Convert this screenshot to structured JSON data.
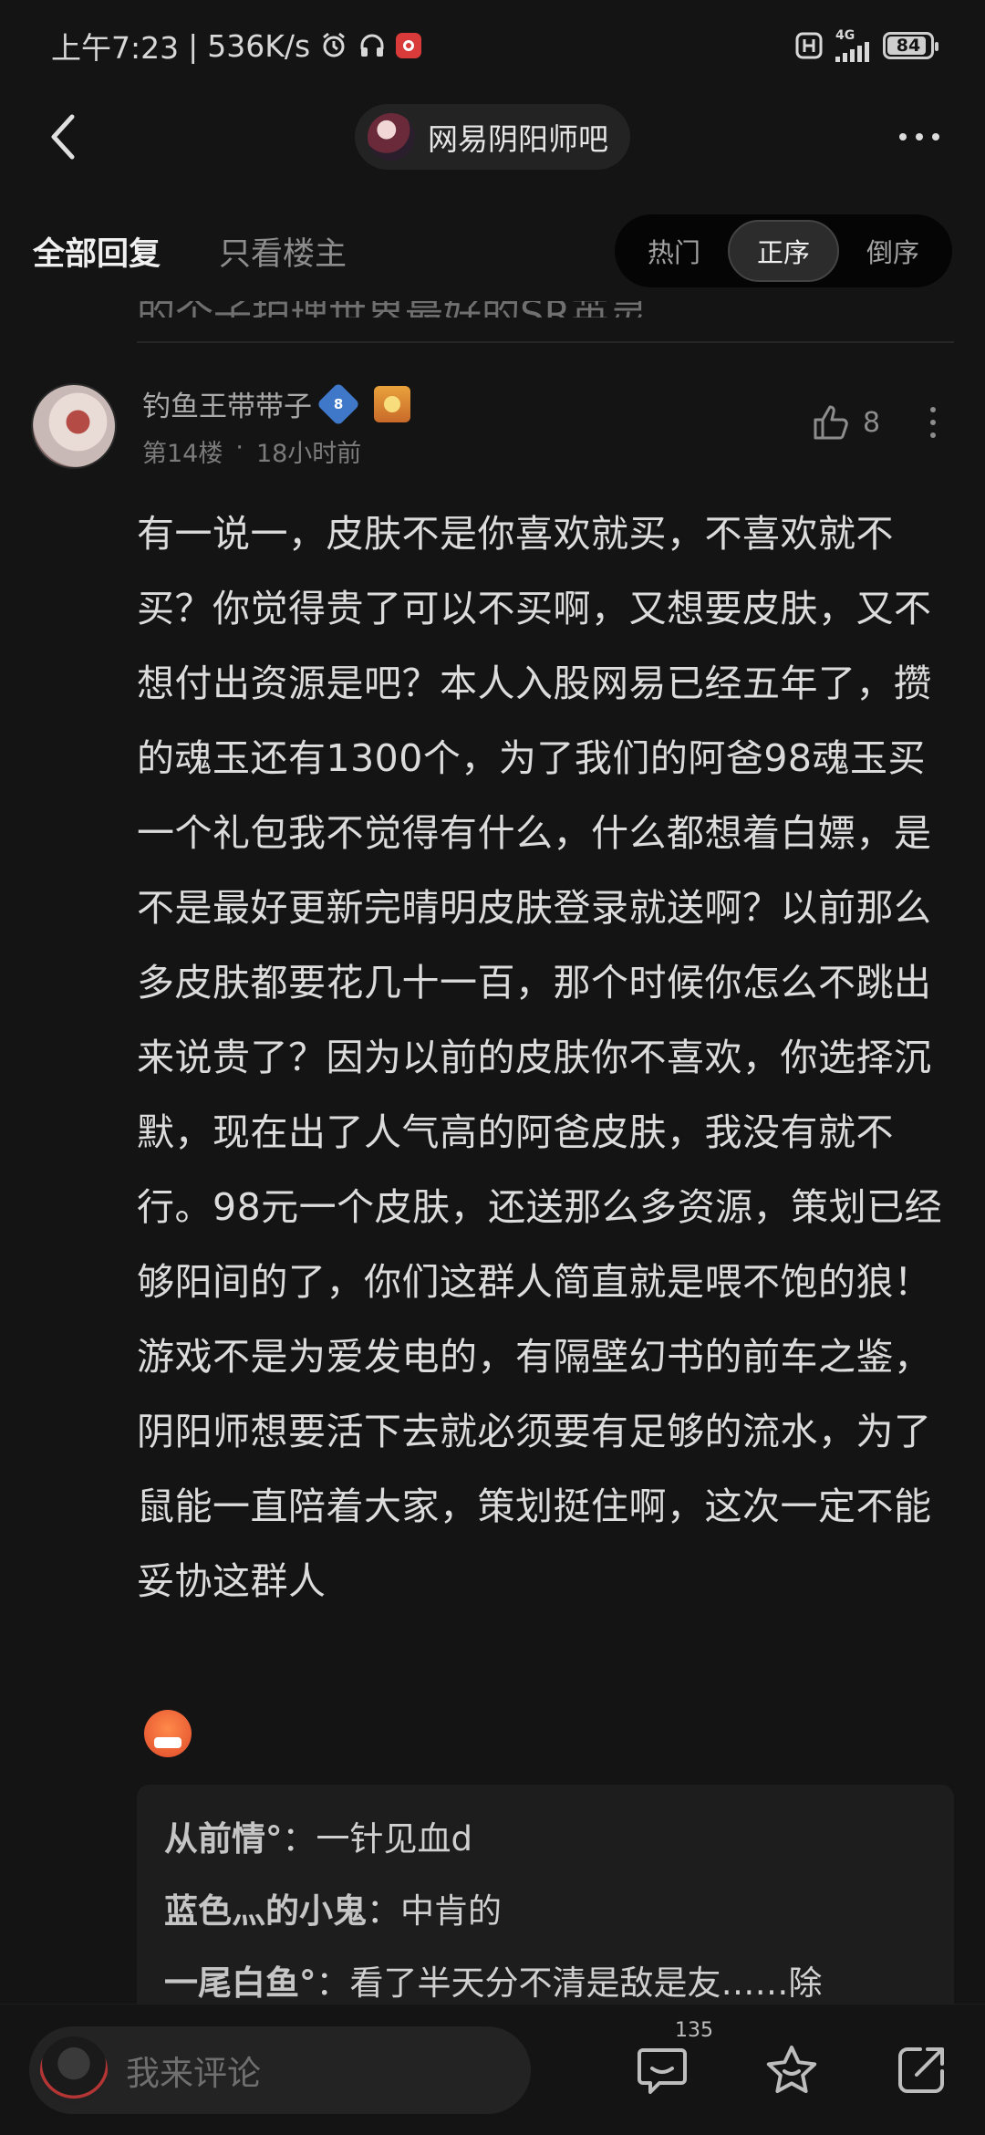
{
  "status_bar": {
    "time": "上午7:23",
    "speed": "536K/s",
    "net_type": "4G",
    "battery": "84"
  },
  "nav": {
    "forum_name": "网易阴阳师吧"
  },
  "filter": {
    "all_replies": "全部回复",
    "only_op": "只看楼主",
    "sort_options": [
      "热门",
      "正序",
      "倒序"
    ],
    "active_sort": "正序"
  },
  "previous_snippet": "的个子护理世界最好的SR英灵",
  "post": {
    "username": "钓鱼王带带子",
    "level": "8",
    "floor": "第14楼",
    "separator": "·",
    "time": "18小时前",
    "likes": "8",
    "content": "有一说一，皮肤不是你喜欢就买，不喜欢就不买？你觉得贵了可以不买啊，又想要皮肤，又不想付出资源是吧？本人入股网易已经五年了，攒的魂玉还有1300个，为了我们的阿爸98魂玉买一个礼包我不觉得有什么，什么都想着白嫖，是不是最好更新完晴明皮肤登录就送啊？以前那么多皮肤都要花几十一百，那个时候你怎么不跳出来说贵了？因为以前的皮肤你不喜欢，你选择沉默，现在出了人气高的阿爸皮肤，我没有就不行。98元一个皮肤，还送那么多资源，策划已经够阳间的了，你们这群人简直就是喂不饱的狼！游戏不是为爱发电的，有隔壁幻书的前车之鉴，阴阳师想要活下去就必须要有足够的流水，为了鼠能一直陪着大家，策划挺住啊，这次一定不能妥协这群人"
  },
  "sub_replies": [
    {
      "author": "从前情°",
      "sep": "：",
      "text": "一针见血d"
    },
    {
      "author": "蓝色灬的小鬼",
      "sep": "：",
      "text": "中肯的"
    },
    {
      "author": "一尾白鱼°",
      "sep": "：",
      "text": "看了半天分不清是敌是友……除"
    }
  ],
  "bottom_bar": {
    "placeholder": "我来评论",
    "comment_count": "135"
  }
}
